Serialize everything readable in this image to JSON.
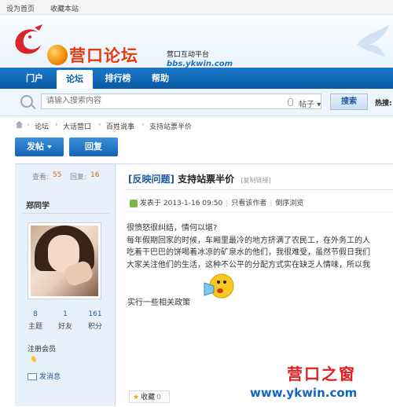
{
  "topbar": {
    "home_link": "设为首页",
    "bookmark_link": "收藏本站"
  },
  "header": {
    "logo_text": "营口论坛",
    "slogan": "营口互动平台",
    "domain": "bbs.ykwin.com"
  },
  "nav": {
    "items": [
      "门户",
      "论坛",
      "排行榜",
      "帮助"
    ],
    "active": "论坛"
  },
  "search": {
    "placeholder": "请输入搜索内容",
    "type_label": "帖子",
    "button_label": "搜索",
    "hot_label": "热搜:"
  },
  "breadcrumb": [
    "论坛",
    "大话营口",
    "百姓说事",
    "支持站票半价"
  ],
  "actions": {
    "post_label": "发帖",
    "reply_label": "回复"
  },
  "thread_stats": {
    "views_label": "查看:",
    "views": "55",
    "replies_label": "回复:",
    "replies": "16"
  },
  "author": {
    "name": "郑同学",
    "stats": [
      {
        "value": "8",
        "label": "主题"
      },
      {
        "value": "1",
        "label": "好友"
      },
      {
        "value": "161",
        "label": "积分"
      }
    ],
    "role": "注册会员",
    "message_label": "发消息"
  },
  "post": {
    "tag": "[反映问题]",
    "title": "支持站票半价",
    "copy_link": "[复制链接]",
    "posted_at": "发表于 2013-1-16 09:50",
    "only_author": "只看该作者",
    "reverse_view": "倒序浏览",
    "paragraphs": [
      "很愤怒很纠结，情何以堪?",
      "每年假期回家的时候，车厢里最冷的地方挤满了农民工，在外务工的人",
      "吃着干巴巴的饼喝着冰凉的矿泉水的他们，我很难受，虽然节假日我们",
      "大家关注他们的生活，这种不公平的分配方式实在缺乏人情味，所以我"
    ],
    "closing": "实行一些相关政策",
    "favorite_label": "收藏",
    "favorite_count": "0"
  },
  "watermark": {
    "site_name": "营口之窗",
    "url": "www.ykwin.com"
  },
  "colors": {
    "nav_blue": "#0b5aa5",
    "accent_orange": "#e05b1a",
    "watermark_red": "#e02020"
  }
}
